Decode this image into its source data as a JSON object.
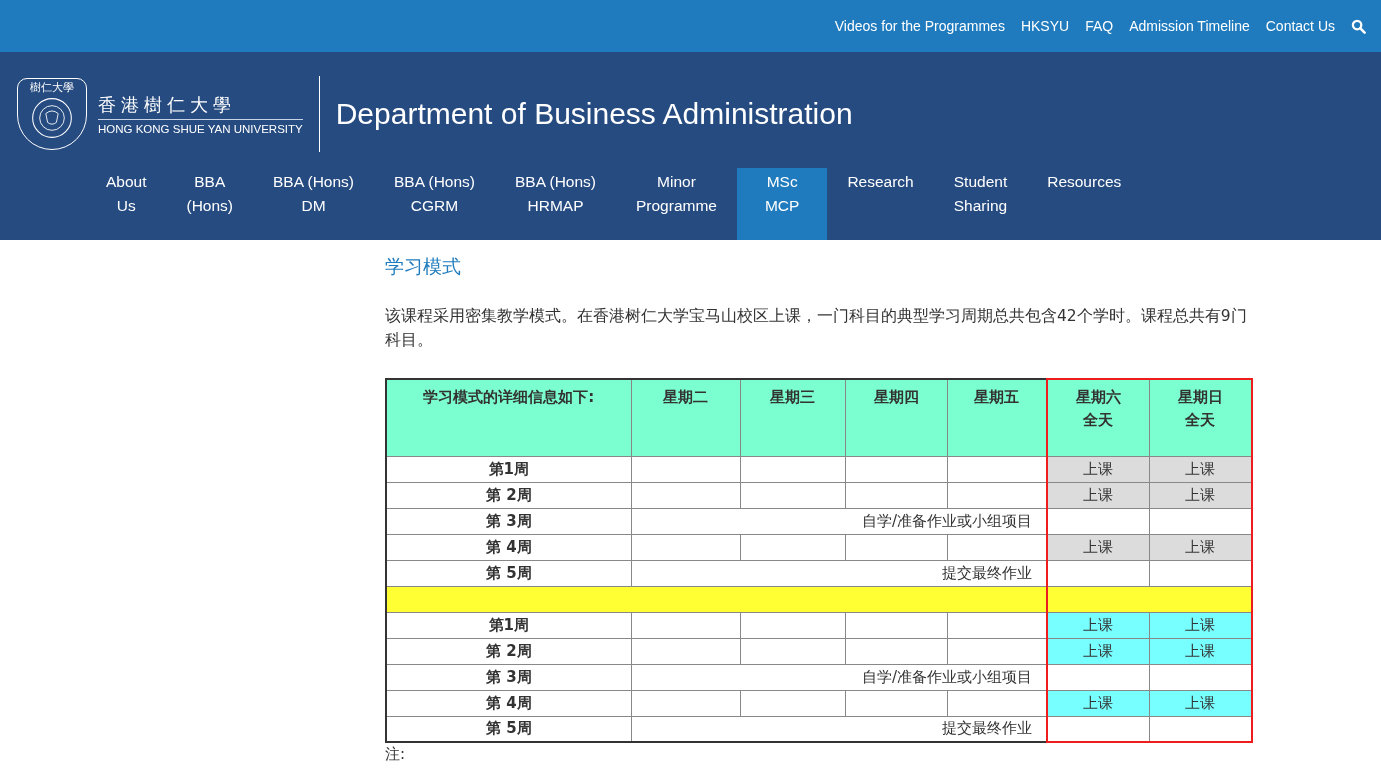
{
  "top_links": [
    "Videos for the Programmes",
    "HKSYU",
    "FAQ",
    "Admission Timeline",
    "Contact Us"
  ],
  "logo": {
    "badge_text": "樹仁大學",
    "name_zh": "香港樹仁大學",
    "name_en": "HONG KONG SHUE YAN UNIVERSITY"
  },
  "department": "Department of Business Administration",
  "nav": [
    {
      "label": "About\nUs",
      "selected": false
    },
    {
      "label": "BBA\n(Hons)",
      "selected": false
    },
    {
      "label": "BBA (Hons)\nDM",
      "selected": false
    },
    {
      "label": "BBA (Hons)\nCGRM",
      "selected": false
    },
    {
      "label": "BBA (Hons)\nHRMAP",
      "selected": false
    },
    {
      "label": "Minor\nProgramme",
      "selected": false
    },
    {
      "label": "MSc\nMCP",
      "selected": true
    },
    {
      "label": "Research",
      "selected": false
    },
    {
      "label": "Student\nSharing",
      "selected": false
    },
    {
      "label": "Resources",
      "selected": false
    }
  ],
  "section_title": "学习模式",
  "intro": "该课程采用密集教学模式。在香港树仁大学宝马山校区上课，一门科目的典型学习周期总共包含42个学时。课程总共有9门科目。",
  "table": {
    "columns": [
      {
        "label": "学习模式的详细信息如下:",
        "highlighted": false
      },
      {
        "label": "星期二",
        "highlighted": false
      },
      {
        "label": "星期三",
        "highlighted": false
      },
      {
        "label": "星期四",
        "highlighted": false
      },
      {
        "label": "星期五",
        "highlighted": false
      },
      {
        "label": "星期六",
        "sublabel": "全天",
        "highlighted": true
      },
      {
        "label": "星期日",
        "sublabel": "全天",
        "highlighted": true
      }
    ],
    "rows": [
      {
        "kind": "week",
        "week": "第1周",
        "weekend": [
          {
            "text": "上课",
            "color": "#dcdcdc"
          },
          {
            "text": "上课",
            "color": "#dcdcdc"
          }
        ]
      },
      {
        "kind": "week",
        "week": "第 2周",
        "weekend": [
          {
            "text": "上课",
            "color": "#dcdcdc"
          },
          {
            "text": "上课",
            "color": "#dcdcdc"
          }
        ]
      },
      {
        "kind": "span",
        "week": "第 3周",
        "note": "自学/准备作业或小组项目"
      },
      {
        "kind": "week",
        "week": "第 4周",
        "weekend": [
          {
            "text": "上课",
            "color": "#dcdcdc"
          },
          {
            "text": "上课",
            "color": "#dcdcdc"
          }
        ]
      },
      {
        "kind": "span",
        "week": "第 5周",
        "note": "提交最终作业"
      },
      {
        "kind": "divider"
      },
      {
        "kind": "week",
        "week": "第1周",
        "weekend": [
          {
            "text": "上课",
            "color": "#77ffff"
          },
          {
            "text": "上课",
            "color": "#77ffff"
          }
        ]
      },
      {
        "kind": "week",
        "week": "第 2周",
        "weekend": [
          {
            "text": "上课",
            "color": "#77ffff"
          },
          {
            "text": "上课",
            "color": "#77ffff"
          }
        ]
      },
      {
        "kind": "span",
        "week": "第 3周",
        "note": "自学/准备作业或小组项目"
      },
      {
        "kind": "week",
        "week": "第 4周",
        "weekend": [
          {
            "text": "上课",
            "color": "#77ffff"
          },
          {
            "text": "上课",
            "color": "#77ffff"
          }
        ]
      },
      {
        "kind": "span",
        "week": "第 5周",
        "note": "提交最终作业"
      }
    ]
  },
  "note_label": "注:"
}
